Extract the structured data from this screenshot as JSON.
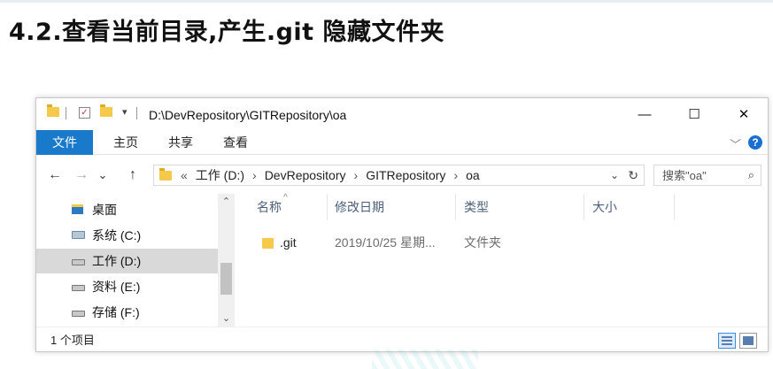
{
  "slide": {
    "title": "4.2.查看当前目录,产生.git 隐藏文件夹"
  },
  "window": {
    "title_path": "D:\\DevRepository\\GITRepository\\oa",
    "quick_access_dropdown": "▾",
    "controls": {
      "minimize": "—",
      "maximize": "☐",
      "close": "✕"
    }
  },
  "ribbon": {
    "tabs": [
      {
        "label": "文件",
        "active": true
      },
      {
        "label": "主页"
      },
      {
        "label": "共享"
      },
      {
        "label": "查看"
      }
    ],
    "expand_icon": "﹀",
    "help": "?"
  },
  "nav": {
    "back": "←",
    "forward": "→",
    "recent": "⌄",
    "up": "↑",
    "address": {
      "overflow": "«",
      "crumbs": [
        "工作 (D:)",
        "DevRepository",
        "GITRepository",
        "oa"
      ],
      "separator": "›",
      "dropdown": "⌄",
      "refresh": "↻"
    },
    "search": {
      "placeholder": "搜索\"oa\"",
      "icon": "⌕"
    }
  },
  "navpane": {
    "items": [
      {
        "label": "桌面",
        "icon": "desktop-icon"
      },
      {
        "label": "系统 (C:)",
        "icon": "system-drive-icon"
      },
      {
        "label": "工作 (D:)",
        "icon": "drive-icon",
        "selected": true
      },
      {
        "label": "资料 (E:)",
        "icon": "drive-icon"
      },
      {
        "label": "存储 (F:)",
        "icon": "drive-icon"
      }
    ],
    "scroll_up": "⌃",
    "scroll_down": "⌄"
  },
  "filelist": {
    "columns": [
      "名称",
      "修改日期",
      "类型",
      "大小"
    ],
    "sort_indicator": "^",
    "rows": [
      {
        "name": ".git",
        "modified": "2019/10/25 星期...",
        "type": "文件夹",
        "size": ""
      }
    ]
  },
  "status": {
    "count": "1 个项目"
  },
  "colors": {
    "file_tab": "#1979ca",
    "selection": "#d9d9d9",
    "folder": "#f6c94a"
  }
}
